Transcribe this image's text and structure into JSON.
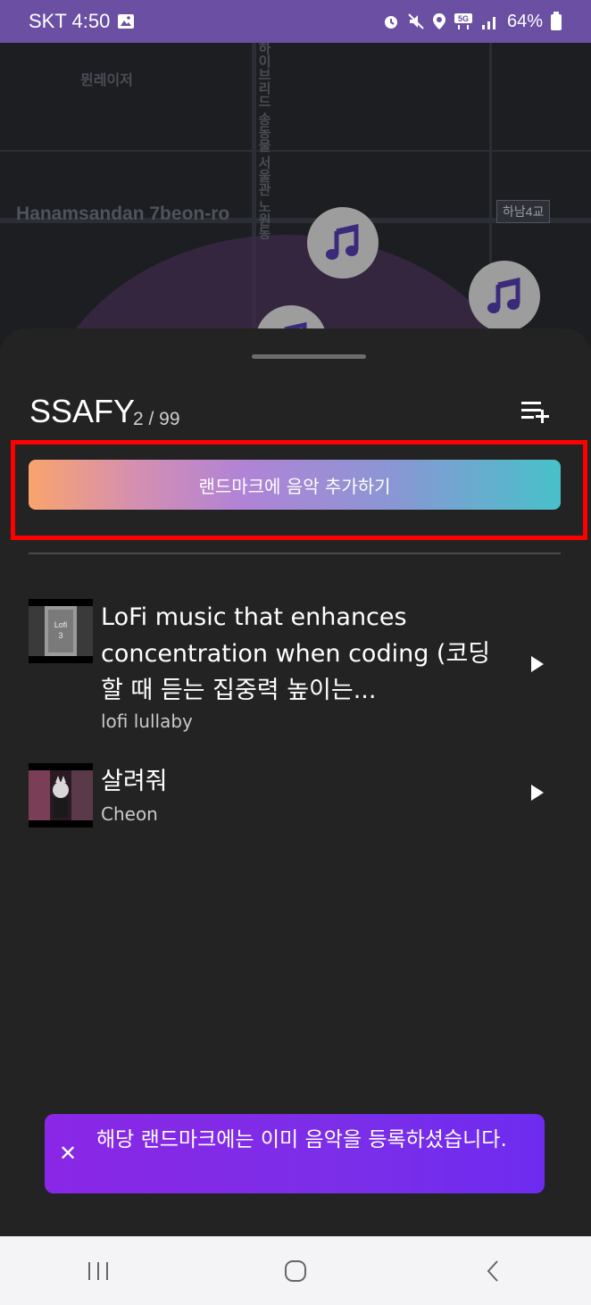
{
  "status_bar": {
    "carrier_time": "SKT 4:50",
    "battery": "64%",
    "icons": [
      "gallery-icon",
      "alarm-icon",
      "mute-icon",
      "location-icon",
      "5g-icon",
      "signal-icon",
      "battery-icon"
    ]
  },
  "map": {
    "road_label": "Hanamsandan 7beon-ro",
    "building_label": "뮌레이저",
    "vertical_label": "하이브리드 송동물 서울관 노원동",
    "box_label": "하남4교",
    "marker_icon": "music-note-icon"
  },
  "playlist": {
    "title": "SSAFY",
    "count": "2 / 99",
    "add_button_label": "랜드마크에 음악 추가하기",
    "tracks": [
      {
        "title": "LoFi music that enhances concentration when coding (코딩할 때 듣는 집중력 높이는...",
        "artist": "lofi lullaby"
      },
      {
        "title": "살려줘",
        "artist": "Cheon"
      }
    ]
  },
  "toast": {
    "message": "해당 랜드마크에는 이미 음악을 등록하셨습니다."
  },
  "colors": {
    "status_bar": "#6a4fa3",
    "sheet": "#232323",
    "toast": "#8a27e6",
    "highlight": "#ff0000"
  }
}
